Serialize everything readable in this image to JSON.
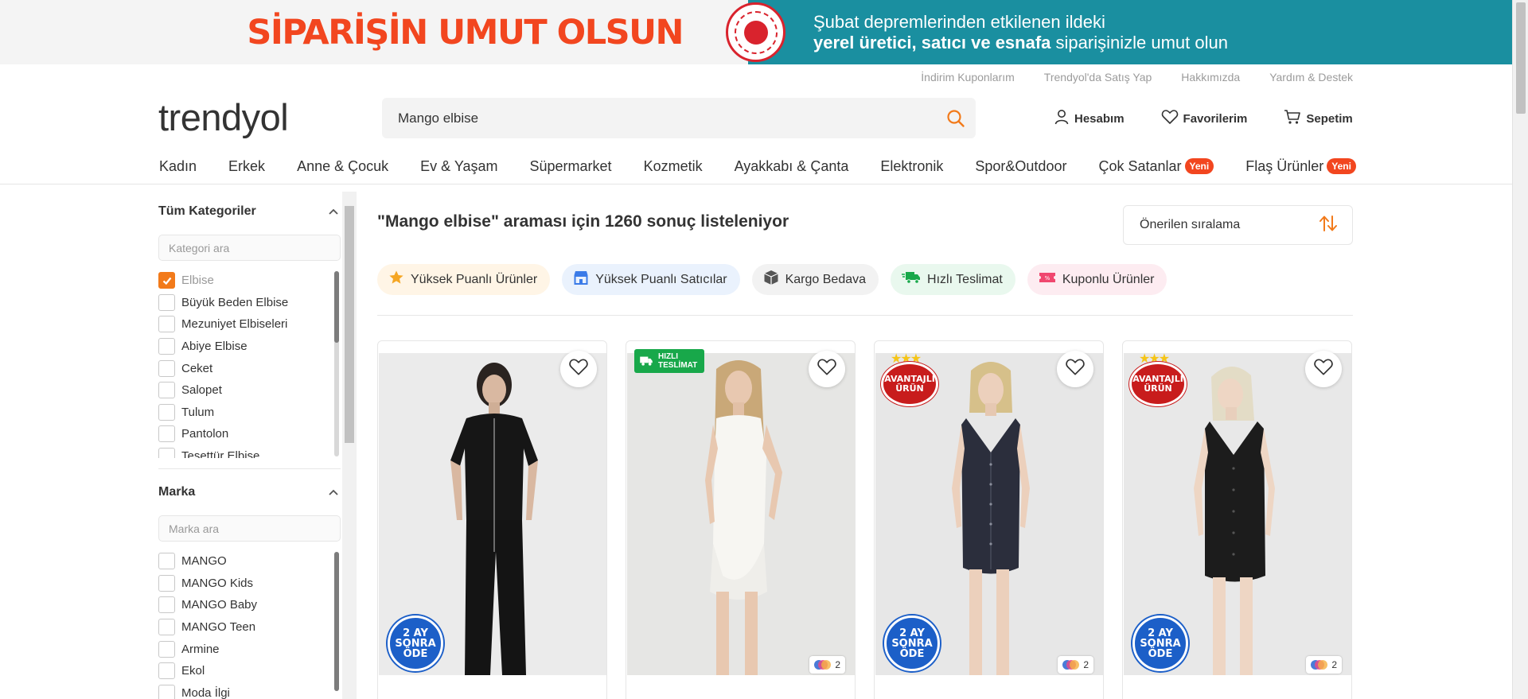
{
  "banner": {
    "title": "SİPARİŞİN UMUT OLSUN",
    "line1": "Şubat depremlerinden etkilenen ildeki",
    "line2_bold": "yerel üretici, satıcı ve esnafa",
    "line2_rest": " siparişinizle umut olun"
  },
  "top_links": [
    "İndirim Kuponlarım",
    "Trendyol'da Satış Yap",
    "Hakkımızda",
    "Yardım & Destek"
  ],
  "logo": "trendyol",
  "search": {
    "value": "Mango elbise",
    "icon": "search-icon",
    "accent": "#f27a1a"
  },
  "header_actions": [
    {
      "label": "Hesabım",
      "icon": "user-icon"
    },
    {
      "label": "Favorilerim",
      "icon": "heart-icon"
    },
    {
      "label": "Sepetim",
      "icon": "cart-icon"
    }
  ],
  "categories": [
    {
      "label": "Kadın"
    },
    {
      "label": "Erkek"
    },
    {
      "label": "Anne & Çocuk"
    },
    {
      "label": "Ev & Yaşam"
    },
    {
      "label": "Süpermarket"
    },
    {
      "label": "Kozmetik"
    },
    {
      "label": "Ayakkabı & Çanta"
    },
    {
      "label": "Elektronik"
    },
    {
      "label": "Spor&Outdoor"
    },
    {
      "label": "Çok Satanlar",
      "badge": "Yeni"
    },
    {
      "label": "Flaş Ürünler",
      "badge": "Yeni"
    }
  ],
  "sidebar": {
    "category_filter": {
      "title": "Tüm Kategoriler",
      "placeholder": "Kategori ara",
      "items": [
        {
          "label": "Elbise",
          "checked": true
        },
        {
          "label": "Büyük Beden Elbise",
          "checked": false
        },
        {
          "label": "Mezuniyet Elbiseleri",
          "checked": false
        },
        {
          "label": "Abiye Elbise",
          "checked": false
        },
        {
          "label": "Ceket",
          "checked": false
        },
        {
          "label": "Salopet",
          "checked": false
        },
        {
          "label": "Tulum",
          "checked": false
        },
        {
          "label": "Pantolon",
          "checked": false
        },
        {
          "label": "Tesettür Elbise",
          "checked": false
        }
      ]
    },
    "brand_filter": {
      "title": "Marka",
      "placeholder": "Marka ara",
      "items": [
        {
          "label": "MANGO",
          "checked": false
        },
        {
          "label": "MANGO Kids",
          "checked": false
        },
        {
          "label": "MANGO Baby",
          "checked": false
        },
        {
          "label": "MANGO Teen",
          "checked": false
        },
        {
          "label": "Armine",
          "checked": false
        },
        {
          "label": "Ekol",
          "checked": false
        },
        {
          "label": "Moda İlgi",
          "checked": false
        }
      ]
    }
  },
  "results": {
    "query": "\"Mango elbise\"",
    "summary": " araması için 1260 sonuç listeleniyor"
  },
  "sort": {
    "label": "Önerilen sıralama",
    "icon": "sort-arrows-icon"
  },
  "quick_filters": [
    {
      "label": "Yüksek Puanlı Ürünler",
      "icon": "star-icon",
      "bg": "#fff5e6",
      "color": "#f5a623"
    },
    {
      "label": "Yüksek Puanlı Satıcılar",
      "icon": "store-icon",
      "bg": "#eaf2fd",
      "color": "#3b7be8"
    },
    {
      "label": "Kargo Bedava",
      "icon": "box-icon",
      "bg": "#f2f2f2",
      "color": "#555555"
    },
    {
      "label": "Hızlı Teslimat",
      "icon": "truck-icon",
      "bg": "#e9f8ee",
      "color": "#18a84a"
    },
    {
      "label": "Kuponlu Ürünler",
      "icon": "coupon-icon",
      "bg": "#fdecf1",
      "color": "#f0476f"
    }
  ],
  "products": [
    {
      "sticker_top": "",
      "sticker_pay": "2 AY SONRA ÖDE",
      "color_count": "",
      "garment": "jumpsuit-black"
    },
    {
      "sticker_top": "HIZLI TESLİMAT",
      "sticker_pay": "",
      "color_count": "2",
      "garment": "dress-white"
    },
    {
      "sticker_top": "AVANTAJLI ÜRÜN",
      "sticker_pay": "2 AY SONRA ÖDE",
      "color_count": "2",
      "garment": "dress-navy"
    },
    {
      "sticker_top": "AVANTAJLI ÜRÜN",
      "sticker_pay": "2 AY SONRA ÖDE",
      "color_count": "2",
      "garment": "dress-black"
    }
  ]
}
